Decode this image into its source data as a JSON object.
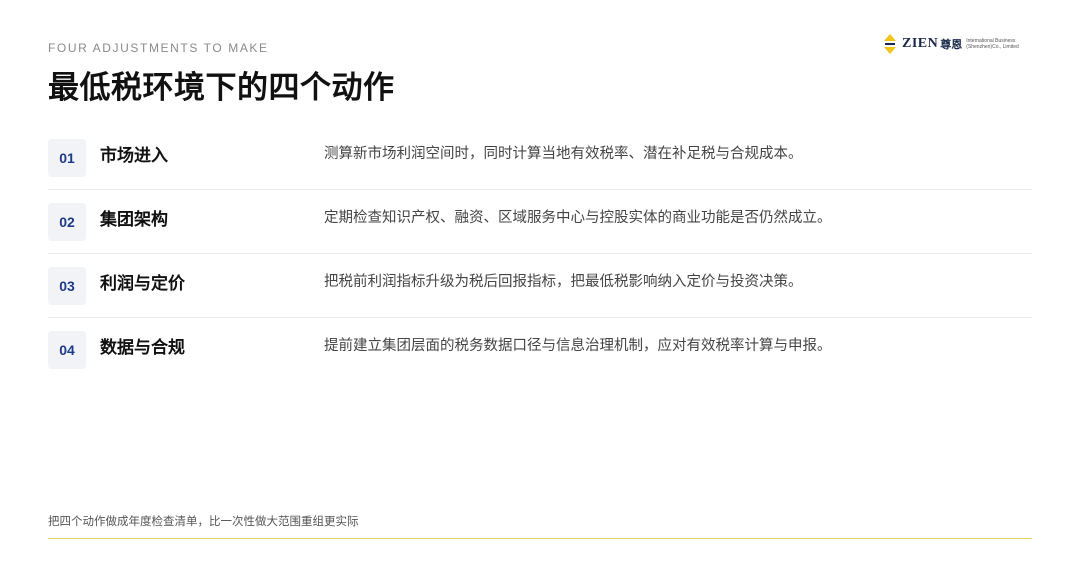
{
  "eyebrow": "FOUR ADJUSTMENTS TO MAKE",
  "title": "最低税环境下的四个动作",
  "logo": {
    "word": "ZIEN",
    "cn": "尊恩",
    "line1": "International Business",
    "line2": "(Shenzhen)Co., Limited",
    "accent_color": "#f0c419",
    "brand_color": "#1b2a4a"
  },
  "rows": [
    {
      "num": "01",
      "title": "市场进入",
      "desc": "测算新市场利润空间时，同时计算当地有效税率、潜在补足税与合规成本。"
    },
    {
      "num": "02",
      "title": "集团架构",
      "desc": "定期检查知识产权、融资、区域服务中心与控股实体的商业功能是否仍然成立。"
    },
    {
      "num": "03",
      "title": "利润与定价",
      "desc": "把税前利润指标升级为税后回报指标，把最低税影响纳入定价与投资决策。"
    },
    {
      "num": "04",
      "title": "数据与合规",
      "desc": "提前建立集团层面的税务数据口径与信息治理机制，应对有效税率计算与申报。"
    }
  ],
  "footer": "把四个动作做成年度检查清单，比一次性做大范围重组更实际"
}
